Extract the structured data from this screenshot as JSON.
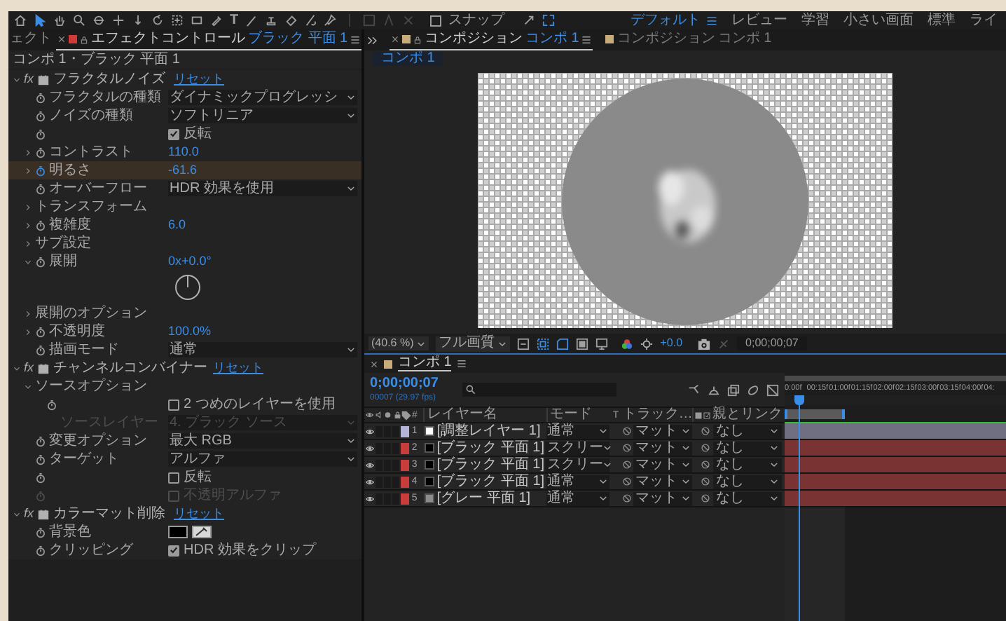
{
  "toolbar": {
    "tools": [
      {
        "kind": "home",
        "selected": false
      },
      {
        "kind": "pointer",
        "selected": true
      },
      {
        "kind": "hand",
        "selected": false
      },
      {
        "kind": "zoom",
        "selected": false
      },
      {
        "kind": "orbit",
        "selected": false
      },
      {
        "kind": "plus",
        "selected": false
      },
      {
        "kind": "down",
        "selected": false
      },
      {
        "kind": "rotate",
        "selected": false
      },
      {
        "kind": "anchor",
        "selected": false
      },
      {
        "kind": "rect",
        "selected": false
      },
      {
        "kind": "pen",
        "selected": false
      },
      {
        "kind": "text",
        "glyph": "T",
        "selected": false
      },
      {
        "kind": "brush",
        "selected": false
      },
      {
        "kind": "stamp",
        "selected": false
      },
      {
        "kind": "eraser",
        "selected": false
      },
      {
        "kind": "roto",
        "selected": false
      },
      {
        "kind": "pin",
        "selected": false
      }
    ],
    "snap": {
      "label": "スナップ",
      "checked": false
    },
    "workspaces": [
      {
        "label": "デフォルト",
        "selected": true
      },
      {
        "label": "レビュー",
        "selected": false
      },
      {
        "label": "学習",
        "selected": false
      },
      {
        "label": "小さい画面",
        "selected": false
      },
      {
        "label": "標準",
        "selected": false
      },
      {
        "label": "ライ",
        "selected": false
      }
    ]
  },
  "effect_controls": {
    "tabs": [
      {
        "title": "ェクト",
        "selected": false
      },
      {
        "title": "エフェクトコントロール",
        "subject": "ブラック 平面 1",
        "selected": true
      }
    ],
    "breadcrumb": "コンポ 1・ブラック 平面 1",
    "effects": [
      {
        "kind": "effect",
        "badge": "fx",
        "label": "フラクタルノイズ",
        "reset": "リセット",
        "expanded": true,
        "selected": false,
        "children": [
          {
            "kind": "dropdown",
            "label": "フラクタルの種類",
            "value": "ダイナミックプログレッシ",
            "animated": false,
            "selected": false
          },
          {
            "kind": "dropdown",
            "label": "ノイズの種類",
            "value": "ソフトリニア",
            "animated": false,
            "selected": false
          },
          {
            "kind": "checkbox",
            "text": "反転",
            "checked": true,
            "animated": false,
            "selected": false
          },
          {
            "kind": "number",
            "label": "コントラスト",
            "value": "110.0",
            "expanded": false,
            "animated": false,
            "selected": false
          },
          {
            "kind": "number",
            "label": "明るさ",
            "value": "-61.6",
            "expanded": false,
            "animated": true,
            "selected": true
          },
          {
            "kind": "dropdown",
            "label": "オーバーフロー",
            "value": "HDR 効果を使用",
            "animated": false,
            "selected": false
          },
          {
            "kind": "group",
            "label": "トランスフォーム",
            "expanded": false,
            "selected": false
          },
          {
            "kind": "number",
            "label": "複雑度",
            "value": "6.0",
            "expanded": false,
            "animated": false,
            "selected": false
          },
          {
            "kind": "group",
            "label": "サブ設定",
            "expanded": false,
            "selected": false
          },
          {
            "kind": "angle",
            "label": "展開",
            "value": "0x+0.0°",
            "expanded": true,
            "animated": false,
            "selected": false
          },
          {
            "kind": "group",
            "label": "展開のオプション",
            "expanded": false,
            "selected": false
          },
          {
            "kind": "number",
            "label": "不透明度",
            "value": "100.0%",
            "expanded": false,
            "animated": false,
            "selected": false
          },
          {
            "kind": "dropdown",
            "label": "描画モード",
            "value": "通常",
            "animated": false,
            "selected": false
          }
        ]
      },
      {
        "kind": "effect",
        "badge": "fx",
        "label": "チャンネルコンバイナー",
        "reset": "リセット",
        "expanded": true,
        "selected": false,
        "children": [
          {
            "kind": "group",
            "label": "ソースオプション",
            "expanded": true,
            "selected": false,
            "disabled": false,
            "children": [
              {
                "kind": "checkbox",
                "text": "2 つめのレイヤーを使用",
                "checked": false,
                "animated": false,
                "selected": false,
                "disabled": false
              },
              {
                "kind": "dropdown",
                "label": "ソースレイヤー",
                "value": "4. ブラック ソース",
                "selected": false,
                "disabled": true
              }
            ]
          },
          {
            "kind": "dropdown",
            "label": "変更オプション",
            "value": "最大 RGB",
            "animated": false,
            "selected": false,
            "disabled": false
          },
          {
            "kind": "dropdown",
            "label": "ターゲット",
            "value": "アルファ",
            "animated": false,
            "selected": false,
            "disabled": false
          },
          {
            "kind": "checkbox",
            "text": "反転",
            "checked": false,
            "animated": false,
            "selected": false,
            "disabled": false
          },
          {
            "kind": "checkbox",
            "text": "不透明アルファ",
            "checked": false,
            "animated": false,
            "selected": false,
            "disabled": true
          }
        ]
      },
      {
        "kind": "effect",
        "badge": "fx",
        "label": "カラーマット削除",
        "reset": "リセット",
        "expanded": true,
        "selected": false,
        "children": [
          {
            "kind": "color",
            "label": "背景色",
            "animated": false,
            "selected": false
          },
          {
            "kind": "checkbox",
            "label": "クリッピング",
            "text": "HDR 効果をクリップ",
            "checked": true,
            "animated": false,
            "selected": false
          }
        ]
      }
    ]
  },
  "viewer": {
    "tabs": [
      {
        "title": "コンポジション",
        "subject": "コンポ 1",
        "selected": true
      },
      {
        "title": "コンポジション",
        "subject": "コンポ 1",
        "selected": false
      }
    ],
    "comp_chip": "コンポ 1",
    "zoom": "(40.6 %)",
    "resolution": "フル画質",
    "toggles": [
      {
        "on": false
      },
      {
        "on": true
      },
      {
        "on": true
      },
      {
        "on": false
      },
      {
        "on": false
      }
    ],
    "exposure": "+0.0",
    "timecode": "0;00;00;07"
  },
  "timeline": {
    "tab": "コンポ 1",
    "timecode": "0;00;00;07",
    "frame_info": "00007 (29.97 fps)",
    "columns": {
      "number": "#",
      "name": "レイヤー名",
      "mode": "モード",
      "t": "T",
      "matte": "トラック…",
      "parent": "親とリンク"
    },
    "ruler": [
      "0:00f",
      "00:15f",
      "01:00f",
      "01:15f",
      "02:00f",
      "02:15f",
      "03:00f",
      "03:15f",
      "04:00f",
      "04:"
    ],
    "work_area": {
      "level": 0.27
    },
    "playhead": {
      "level": 0.065
    },
    "layers": [
      {
        "number": "1",
        "name": "[調整レイヤー 1]",
        "color": "#b4b4d8",
        "kind": "adjustment",
        "mode": "通常",
        "matte": "マット",
        "parent": "なし",
        "visible": true
      },
      {
        "number": "2",
        "name": "[ブラック 平面 1]",
        "color": "#c83c3c",
        "kind": "blacksolid",
        "mode": "スクリー",
        "matte": "マット",
        "parent": "なし",
        "visible": true
      },
      {
        "number": "3",
        "name": "[ブラック 平面 1]",
        "color": "#c83c3c",
        "kind": "blacksolid",
        "mode": "スクリー",
        "matte": "マット",
        "parent": "なし",
        "visible": true
      },
      {
        "number": "4",
        "name": "[ブラック 平面 1]",
        "color": "#c83c3c",
        "kind": "blacksolid",
        "mode": "通常",
        "matte": "マット",
        "parent": "なし",
        "visible": true
      },
      {
        "number": "5",
        "name": "[グレー 平面 1]",
        "color": "#c83c3c",
        "kind": "greysolid",
        "mode": "通常",
        "matte": "マット",
        "parent": "なし",
        "visible": true
      }
    ]
  }
}
